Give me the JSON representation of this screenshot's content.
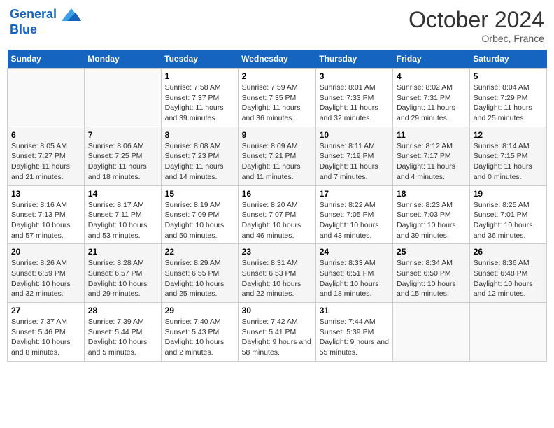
{
  "header": {
    "logo_line1": "General",
    "logo_line2": "Blue",
    "month": "October 2024",
    "location": "Orbec, France"
  },
  "days_of_week": [
    "Sunday",
    "Monday",
    "Tuesday",
    "Wednesday",
    "Thursday",
    "Friday",
    "Saturday"
  ],
  "weeks": [
    [
      {
        "day": "",
        "empty": true
      },
      {
        "day": "",
        "empty": true
      },
      {
        "day": "1",
        "sunrise": "Sunrise: 7:58 AM",
        "sunset": "Sunset: 7:37 PM",
        "daylight": "Daylight: 11 hours and 39 minutes."
      },
      {
        "day": "2",
        "sunrise": "Sunrise: 7:59 AM",
        "sunset": "Sunset: 7:35 PM",
        "daylight": "Daylight: 11 hours and 36 minutes."
      },
      {
        "day": "3",
        "sunrise": "Sunrise: 8:01 AM",
        "sunset": "Sunset: 7:33 PM",
        "daylight": "Daylight: 11 hours and 32 minutes."
      },
      {
        "day": "4",
        "sunrise": "Sunrise: 8:02 AM",
        "sunset": "Sunset: 7:31 PM",
        "daylight": "Daylight: 11 hours and 29 minutes."
      },
      {
        "day": "5",
        "sunrise": "Sunrise: 8:04 AM",
        "sunset": "Sunset: 7:29 PM",
        "daylight": "Daylight: 11 hours and 25 minutes."
      }
    ],
    [
      {
        "day": "6",
        "sunrise": "Sunrise: 8:05 AM",
        "sunset": "Sunset: 7:27 PM",
        "daylight": "Daylight: 11 hours and 21 minutes."
      },
      {
        "day": "7",
        "sunrise": "Sunrise: 8:06 AM",
        "sunset": "Sunset: 7:25 PM",
        "daylight": "Daylight: 11 hours and 18 minutes."
      },
      {
        "day": "8",
        "sunrise": "Sunrise: 8:08 AM",
        "sunset": "Sunset: 7:23 PM",
        "daylight": "Daylight: 11 hours and 14 minutes."
      },
      {
        "day": "9",
        "sunrise": "Sunrise: 8:09 AM",
        "sunset": "Sunset: 7:21 PM",
        "daylight": "Daylight: 11 hours and 11 minutes."
      },
      {
        "day": "10",
        "sunrise": "Sunrise: 8:11 AM",
        "sunset": "Sunset: 7:19 PM",
        "daylight": "Daylight: 11 hours and 7 minutes."
      },
      {
        "day": "11",
        "sunrise": "Sunrise: 8:12 AM",
        "sunset": "Sunset: 7:17 PM",
        "daylight": "Daylight: 11 hours and 4 minutes."
      },
      {
        "day": "12",
        "sunrise": "Sunrise: 8:14 AM",
        "sunset": "Sunset: 7:15 PM",
        "daylight": "Daylight: 11 hours and 0 minutes."
      }
    ],
    [
      {
        "day": "13",
        "sunrise": "Sunrise: 8:16 AM",
        "sunset": "Sunset: 7:13 PM",
        "daylight": "Daylight: 10 hours and 57 minutes."
      },
      {
        "day": "14",
        "sunrise": "Sunrise: 8:17 AM",
        "sunset": "Sunset: 7:11 PM",
        "daylight": "Daylight: 10 hours and 53 minutes."
      },
      {
        "day": "15",
        "sunrise": "Sunrise: 8:19 AM",
        "sunset": "Sunset: 7:09 PM",
        "daylight": "Daylight: 10 hours and 50 minutes."
      },
      {
        "day": "16",
        "sunrise": "Sunrise: 8:20 AM",
        "sunset": "Sunset: 7:07 PM",
        "daylight": "Daylight: 10 hours and 46 minutes."
      },
      {
        "day": "17",
        "sunrise": "Sunrise: 8:22 AM",
        "sunset": "Sunset: 7:05 PM",
        "daylight": "Daylight: 10 hours and 43 minutes."
      },
      {
        "day": "18",
        "sunrise": "Sunrise: 8:23 AM",
        "sunset": "Sunset: 7:03 PM",
        "daylight": "Daylight: 10 hours and 39 minutes."
      },
      {
        "day": "19",
        "sunrise": "Sunrise: 8:25 AM",
        "sunset": "Sunset: 7:01 PM",
        "daylight": "Daylight: 10 hours and 36 minutes."
      }
    ],
    [
      {
        "day": "20",
        "sunrise": "Sunrise: 8:26 AM",
        "sunset": "Sunset: 6:59 PM",
        "daylight": "Daylight: 10 hours and 32 minutes."
      },
      {
        "day": "21",
        "sunrise": "Sunrise: 8:28 AM",
        "sunset": "Sunset: 6:57 PM",
        "daylight": "Daylight: 10 hours and 29 minutes."
      },
      {
        "day": "22",
        "sunrise": "Sunrise: 8:29 AM",
        "sunset": "Sunset: 6:55 PM",
        "daylight": "Daylight: 10 hours and 25 minutes."
      },
      {
        "day": "23",
        "sunrise": "Sunrise: 8:31 AM",
        "sunset": "Sunset: 6:53 PM",
        "daylight": "Daylight: 10 hours and 22 minutes."
      },
      {
        "day": "24",
        "sunrise": "Sunrise: 8:33 AM",
        "sunset": "Sunset: 6:51 PM",
        "daylight": "Daylight: 10 hours and 18 minutes."
      },
      {
        "day": "25",
        "sunrise": "Sunrise: 8:34 AM",
        "sunset": "Sunset: 6:50 PM",
        "daylight": "Daylight: 10 hours and 15 minutes."
      },
      {
        "day": "26",
        "sunrise": "Sunrise: 8:36 AM",
        "sunset": "Sunset: 6:48 PM",
        "daylight": "Daylight: 10 hours and 12 minutes."
      }
    ],
    [
      {
        "day": "27",
        "sunrise": "Sunrise: 7:37 AM",
        "sunset": "Sunset: 5:46 PM",
        "daylight": "Daylight: 10 hours and 8 minutes."
      },
      {
        "day": "28",
        "sunrise": "Sunrise: 7:39 AM",
        "sunset": "Sunset: 5:44 PM",
        "daylight": "Daylight: 10 hours and 5 minutes."
      },
      {
        "day": "29",
        "sunrise": "Sunrise: 7:40 AM",
        "sunset": "Sunset: 5:43 PM",
        "daylight": "Daylight: 10 hours and 2 minutes."
      },
      {
        "day": "30",
        "sunrise": "Sunrise: 7:42 AM",
        "sunset": "Sunset: 5:41 PM",
        "daylight": "Daylight: 9 hours and 58 minutes."
      },
      {
        "day": "31",
        "sunrise": "Sunrise: 7:44 AM",
        "sunset": "Sunset: 5:39 PM",
        "daylight": "Daylight: 9 hours and 55 minutes."
      },
      {
        "day": "",
        "empty": true
      },
      {
        "day": "",
        "empty": true
      }
    ]
  ]
}
